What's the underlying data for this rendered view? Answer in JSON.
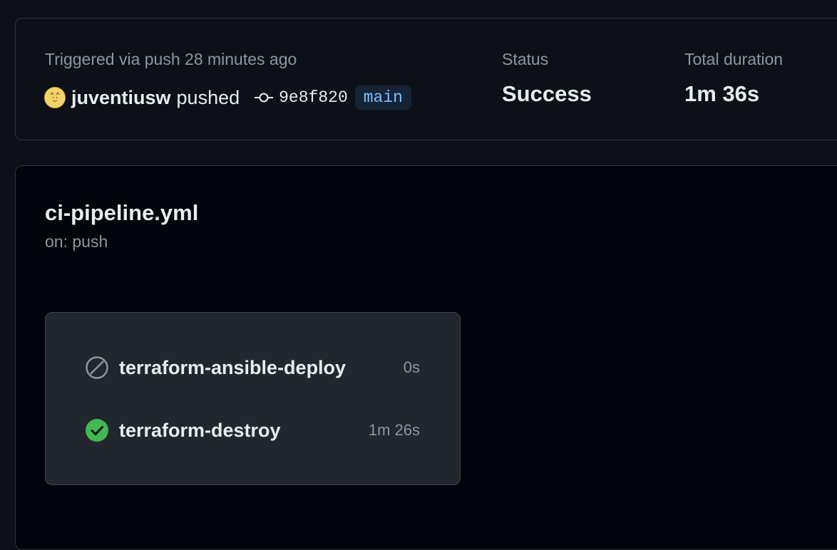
{
  "summary": {
    "trigger_text": "Triggered via push 28 minutes ago",
    "actor": "juventiusw",
    "action": "pushed",
    "commit_sha": "9e8f820",
    "branch": "main",
    "status_label": "Status",
    "status_value": "Success",
    "duration_label": "Total duration",
    "duration_value": "1m 36s"
  },
  "workflow": {
    "file_name": "ci-pipeline.yml",
    "trigger": "on: push",
    "jobs": [
      {
        "name": "terraform-ansible-deploy",
        "duration": "0s",
        "status": "skipped",
        "icon": "skipped-icon"
      },
      {
        "name": "terraform-destroy",
        "duration": "1m 26s",
        "status": "success",
        "icon": "check-circle-icon"
      }
    ]
  },
  "colors": {
    "success": "#3fb950",
    "skipped": "#8d96a0",
    "branch_text": "#79c0ff",
    "branch_bg": "#152337"
  }
}
